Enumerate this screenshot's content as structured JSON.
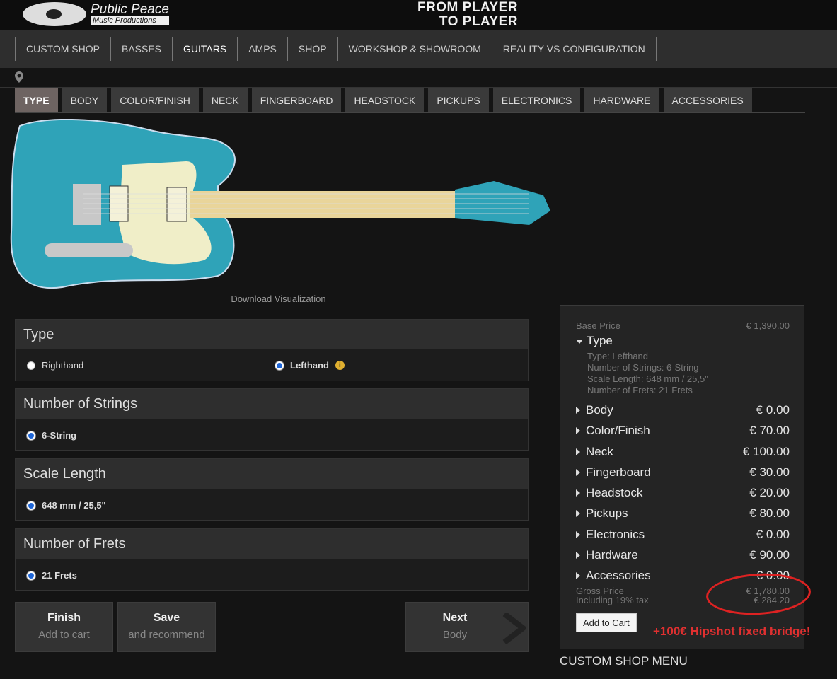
{
  "header": {
    "brand_name": "Public Peace",
    "brand_sub": "Music Productions",
    "slogan_1": "FROM PLAYER",
    "slogan_2": "TO PLAYER"
  },
  "nav": [
    "CUSTOM SHOP",
    "BASSES",
    "GUITARS",
    "AMPS",
    "SHOP",
    "WORKSHOP & SHOWROOM",
    "REALITY VS CONFIGURATION"
  ],
  "tabs": [
    "TYPE",
    "BODY",
    "COLOR/FINISH",
    "NECK",
    "FINGERBOARD",
    "HEADSTOCK",
    "PICKUPS",
    "ELECTRONICS",
    "HARDWARE",
    "ACCESSORIES"
  ],
  "download": "Download Visualization",
  "sections": [
    {
      "title": "Type",
      "options": [
        "Righthand",
        "Lefthand"
      ]
    },
    {
      "title": "Number of Strings",
      "options": [
        "6-String"
      ]
    },
    {
      "title": "Scale Length",
      "options": [
        "648 mm / 25,5\""
      ]
    },
    {
      "title": "Number of Frets",
      "options": [
        "21 Frets"
      ]
    }
  ],
  "buttons": {
    "finish": "Finish",
    "finish_sub": "Add to cart",
    "save": "Save",
    "save_sub": "and recommend",
    "next": "Next",
    "next_sub": "Body"
  },
  "summary": {
    "base_label": "Base Price",
    "base_value": "€ 1,390.00",
    "type_label": "Type",
    "type_details": [
      "Type: Lefthand",
      "Number of Strings: 6-String",
      "Scale Length: 648 mm / 25,5\"",
      "Number of Frets: 21 Frets"
    ],
    "items": [
      {
        "label": "Body",
        "price": "€ 0.00"
      },
      {
        "label": "Color/Finish",
        "price": "€ 70.00"
      },
      {
        "label": "Neck",
        "price": "€ 100.00"
      },
      {
        "label": "Fingerboard",
        "price": "€ 30.00"
      },
      {
        "label": "Headstock",
        "price": "€ 20.00"
      },
      {
        "label": "Pickups",
        "price": "€ 80.00"
      },
      {
        "label": "Electronics",
        "price": "€ 0.00"
      },
      {
        "label": "Hardware",
        "price": "€ 90.00"
      },
      {
        "label": "Accessories",
        "price": "€ 0.00"
      }
    ],
    "gross_label": "Gross Price",
    "gross_value": "€ 1,780.00",
    "tax_label": "Including 19% tax",
    "tax_value": "€ 284.20",
    "add_to_cart": "Add to Cart"
  },
  "annotation": "+100€ Hipshot fixed bridge!",
  "menu_title": "CUSTOM SHOP MENU",
  "colors": {
    "body": "#2fa3b8",
    "pickguard": "#f0eec8",
    "annotation": "#e03030"
  }
}
